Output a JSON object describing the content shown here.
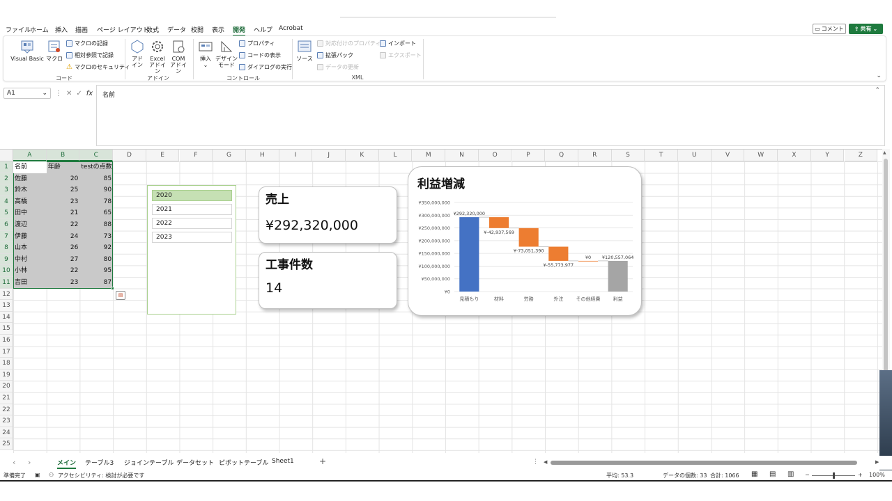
{
  "menu": {
    "tabs": [
      {
        "label": "ファイル",
        "active": false
      },
      {
        "label": "ホーム",
        "active": false
      },
      {
        "label": "挿入",
        "active": false
      },
      {
        "label": "描画",
        "active": false
      },
      {
        "label": "ページ レイアウト",
        "active": false
      },
      {
        "label": "数式",
        "active": false
      },
      {
        "label": "データ",
        "active": false
      },
      {
        "label": "校閲",
        "active": false
      },
      {
        "label": "表示",
        "active": false
      },
      {
        "label": "開発",
        "active": true
      },
      {
        "label": "ヘルプ",
        "active": false
      },
      {
        "label": "Acrobat",
        "active": false
      }
    ],
    "comment_label": "コメント",
    "share_label": "共有"
  },
  "ribbon": {
    "groups": {
      "code": "コード",
      "addins": "アドイン",
      "controls": "コントロール",
      "xml": "XML"
    },
    "code": {
      "visual_basic": "Visual Basic",
      "macro": "マクロ",
      "record_macro": "マクロの記録",
      "relative_ref": "相対参照で記録",
      "macro_security": "マクロのセキュリティ"
    },
    "addins": {
      "addin_l1": "アド",
      "addin_l2": "イン",
      "excel_l1": "Excel",
      "excel_l2": "アドイン",
      "com_l1": "COM",
      "com_l2": "アドイン"
    },
    "controls": {
      "insert": "挿入",
      "design_l1": "デザイン",
      "design_l2": "モード",
      "properties": "プロパティ",
      "view_code": "コードの表示",
      "run_dialog": "ダイアログの実行"
    },
    "xml": {
      "source": "ソース",
      "map_properties": "対応付けのプロパティ",
      "expansion_packs": "拡張パック",
      "refresh_data": "データの更新",
      "import": "インポート",
      "export": "エクスポート"
    }
  },
  "formula_bar": {
    "name_box": "A1",
    "formula": "名前",
    "fx": "fx"
  },
  "grid": {
    "columns": [
      "A",
      "B",
      "C",
      "D",
      "E",
      "F",
      "G",
      "H",
      "I",
      "J",
      "K",
      "L",
      "M",
      "N",
      "O",
      "P",
      "Q",
      "R",
      "S",
      "T",
      "U",
      "V",
      "W",
      "X",
      "Y",
      "Z"
    ],
    "rows": [
      "1",
      "2",
      "3",
      "4",
      "5",
      "6",
      "7",
      "8",
      "9",
      "10",
      "11",
      "12",
      "13",
      "14",
      "15",
      "16",
      "17",
      "18",
      "19",
      "20",
      "21",
      "22",
      "23",
      "24",
      "25"
    ],
    "header": [
      "名前",
      "年齢",
      "testの点数"
    ],
    "data": [
      [
        "佐藤",
        "20",
        "85"
      ],
      [
        "鈴木",
        "25",
        "90"
      ],
      [
        "高橋",
        "23",
        "78"
      ],
      [
        "田中",
        "21",
        "65"
      ],
      [
        "渡辺",
        "22",
        "88"
      ],
      [
        "伊藤",
        "24",
        "73"
      ],
      [
        "山本",
        "26",
        "92"
      ],
      [
        "中村",
        "27",
        "80"
      ],
      [
        "小林",
        "22",
        "95"
      ],
      [
        "吉田",
        "23",
        "87"
      ]
    ]
  },
  "slicer": {
    "items": [
      {
        "label": "2020",
        "selected": true
      },
      {
        "label": "2021",
        "selected": false
      },
      {
        "label": "2022",
        "selected": false
      },
      {
        "label": "2023",
        "selected": false
      }
    ]
  },
  "kpi": {
    "sales": {
      "title": "売上",
      "value": "¥292,320,000"
    },
    "projects": {
      "title": "工事件数",
      "value": "14"
    }
  },
  "chart_data": {
    "type": "bar",
    "subtype": "waterfall",
    "title": "利益増減",
    "categories": [
      "見積もり",
      "材料",
      "労務",
      "外注",
      "その他経費",
      "利益"
    ],
    "values": [
      292320000,
      -42937569,
      -73051390,
      -55773977,
      0,
      120557064
    ],
    "data_labels": [
      "¥292,320,000",
      "¥-42,937,569",
      "¥-73,051,390",
      "¥-55,773,977",
      "¥0",
      "¥120,557,064"
    ],
    "colors": [
      "#4472c4",
      "#ed7d31",
      "#ed7d31",
      "#ed7d31",
      "#ed7d31",
      "#a5a5a5"
    ],
    "yticks": [
      "¥0",
      "¥50,000,000",
      "¥100,000,000",
      "¥150,000,000",
      "¥200,000,000",
      "¥250,000,000",
      "¥300,000,000",
      "¥350,000,000"
    ],
    "ylim": [
      0,
      350000000
    ],
    "grid": true,
    "legend": "none"
  },
  "sheets": {
    "tabs": [
      {
        "label": "メイン",
        "active": true
      },
      {
        "label": "テーブル3",
        "active": false
      },
      {
        "label": "ジョインテーブル",
        "active": false
      },
      {
        "label": "データセット",
        "active": false
      },
      {
        "label": "ピボットテーブル",
        "active": false
      },
      {
        "label": "Sheet1",
        "active": false
      }
    ],
    "add": "+"
  },
  "status": {
    "ready": "準備完了",
    "accessibility": "アクセシビリティ: 検討が必要です",
    "average": "平均: 53.3",
    "count": "データの個数: 33",
    "sum": "合計: 1066",
    "zoom": "100%"
  }
}
